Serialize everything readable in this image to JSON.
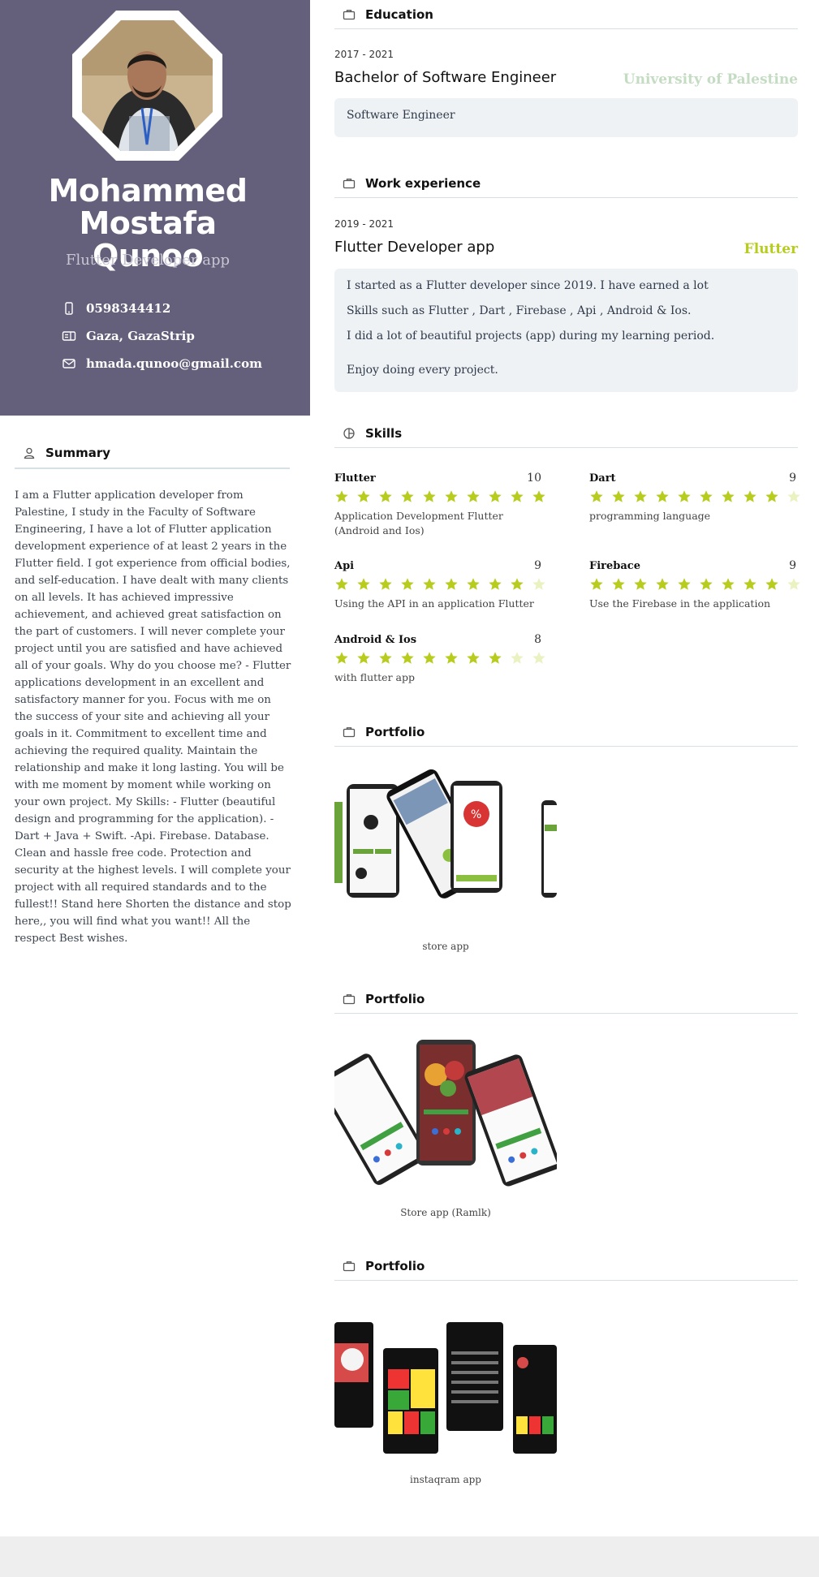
{
  "profile": {
    "name_line1": "Mohammed Mostafa",
    "name_line2": "Qunoo",
    "role": "Flutter Developer app",
    "phone": "0598344412",
    "location": "Gaza, GazaStrip",
    "email": "hmada.qunoo@gmail.com"
  },
  "summary": {
    "title": "Summary",
    "text": "I am a Flutter application developer from Palestine, I study in the Faculty of Software Engineering, I have a lot of Flutter application development experience of at least 2 years in the Flutter field. I got experience from official bodies, and self-education. I have dealt with many clients on all levels. It has achieved impressive achievement, and achieved great satisfaction on the part of customers. I will never complete your project until you are satisfied and have achieved all of your goals. Why do you choose me? - Flutter applications development in an excellent and satisfactory manner for you. Focus with me on the success of your site and achieving all your goals in it. Commitment to excellent time and achieving the required quality. Maintain the relationship and make it long lasting. You will be with me moment by moment while working on your own project. My Skills: - Flutter (beautiful design and programming for the application). - Dart + Java + Swift. -Api. Firebase. Database. Clean and hassle free code. Protection and security at the highest levels. I will complete your project with all required standards and to the fullest!! Stand here Shorten the distance and stop here,, you will find what you want!! All the respect Best wishes."
  },
  "education": {
    "title": "Education",
    "period": "2017 - 2021",
    "degree": "Bachelor of Software Engineer",
    "institution": "University of Palestine",
    "description": "Software Engineer"
  },
  "work": {
    "title": "Work experience",
    "period": "2019 - 2021",
    "position": "Flutter Developer app",
    "company": "Flutter",
    "lines": [
      "I started as a Flutter developer since 2019. I have earned a lot",
      "Skills such as Flutter , Dart , Firebase , Api , Android & Ios.",
      "I did a lot of beautiful projects (app) during my learning period.",
      "Enjoy doing every project."
    ]
  },
  "skills": {
    "title": "Skills",
    "max": 10,
    "items": [
      {
        "name": "Flutter",
        "level": "10",
        "rating": 10,
        "desc": "Application Development Flutter (Android and Ios)"
      },
      {
        "name": "Dart",
        "level": "9",
        "rating": 9,
        "desc": "programming language"
      },
      {
        "name": "Api",
        "level": "9",
        "rating": 9,
        "desc": "Using the API in an application Flutter"
      },
      {
        "name": "Firebace",
        "level": "9",
        "rating": 9,
        "desc": "Use the Firebase in the application"
      },
      {
        "name": "Android & Ios",
        "level": "8",
        "rating": 8,
        "desc": "with flutter app"
      }
    ]
  },
  "portfolio": [
    {
      "title": "Portfolio",
      "caption": "store app",
      "image_icon": "store-app-mockup"
    },
    {
      "title": "Portfolio",
      "caption": "Store app (Ramlk)",
      "image_icon": "ramlk-app-mockup"
    },
    {
      "title": "Portfolio",
      "caption": "instaqram app",
      "image_icon": "instagram-app-mockup"
    }
  ],
  "colors": {
    "sidebar": "#645f7a",
    "accent_green": "#b7cc1c",
    "institution": "#c4dcc2",
    "star_off": "#eaf2c2"
  }
}
